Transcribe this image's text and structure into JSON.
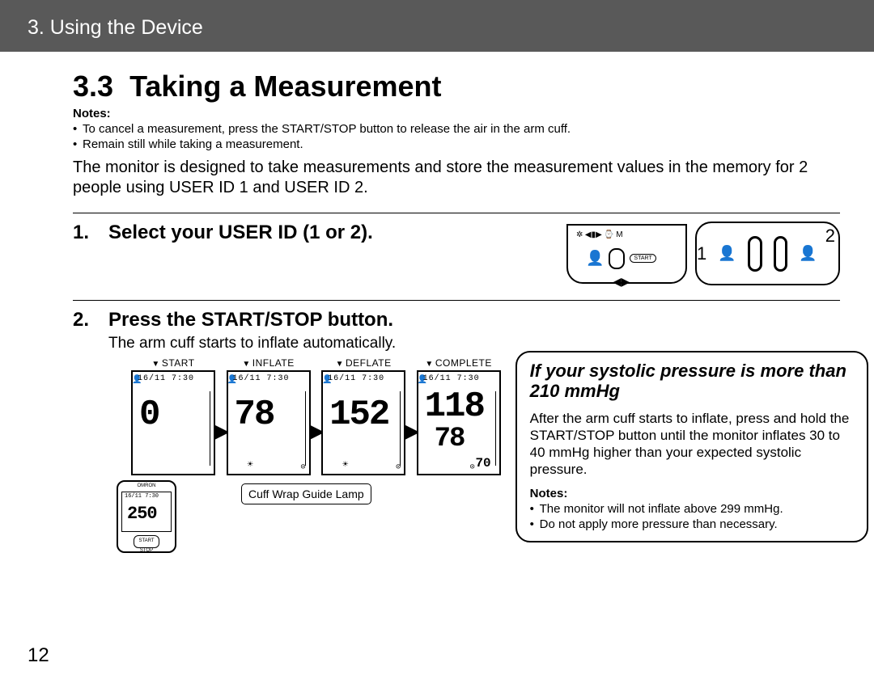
{
  "header": {
    "chapter": "3. Using the Device"
  },
  "section": {
    "number": "3.3",
    "title": "Taking a Measurement"
  },
  "notes_label": "Notes:",
  "top_notes": [
    "To cancel a measurement, press the START/STOP button to release the air in the arm cuff.",
    "Remain still while taking a measurement."
  ],
  "intro": "The monitor is designed to take measurements and store the measurement values in the memory for 2 people using USER ID 1 and USER ID 2.",
  "steps": {
    "s1": {
      "num": "1.",
      "text": "Select your USER ID (1 or 2)."
    },
    "s2": {
      "num": "2.",
      "text": "Press the START/STOP button.",
      "sub": "The arm cuff starts to inflate automatically."
    }
  },
  "switch_labels": {
    "one": "1",
    "two": "2",
    "start_txt": "START"
  },
  "phases": {
    "p1": {
      "label": "START",
      "big": "0",
      "mid": "",
      "small": "",
      "date": "16/11  7:30"
    },
    "p2": {
      "label": "INFLATE",
      "big": "78",
      "mid": "",
      "small": "",
      "date": "16/11  7:30"
    },
    "p3": {
      "label": "DEFLATE",
      "big": "152",
      "mid": "",
      "small": "",
      "date": "16/11  7:30"
    },
    "p4": {
      "label": "COMPLETE",
      "big": "118",
      "mid": "78",
      "small": "70",
      "date": "16/11  7:30"
    }
  },
  "cuff_lamp": "Cuff Wrap Guide Lamp",
  "mini_monitor": {
    "brand": "OMRON",
    "date": "16/11  7:30",
    "value": "250",
    "btn": "START\nSTOP"
  },
  "callout": {
    "title": "If your systolic pressure is more than 210 mmHg",
    "body": "After the arm cuff starts to inflate, press and hold the START/STOP button until the monitor inflates 30 to 40 mmHg higher than your expected systolic pressure.",
    "notes": [
      "The monitor will not inflate above 299 mmHg.",
      "Do not apply more pressure than necessary."
    ]
  },
  "page_number": "12"
}
